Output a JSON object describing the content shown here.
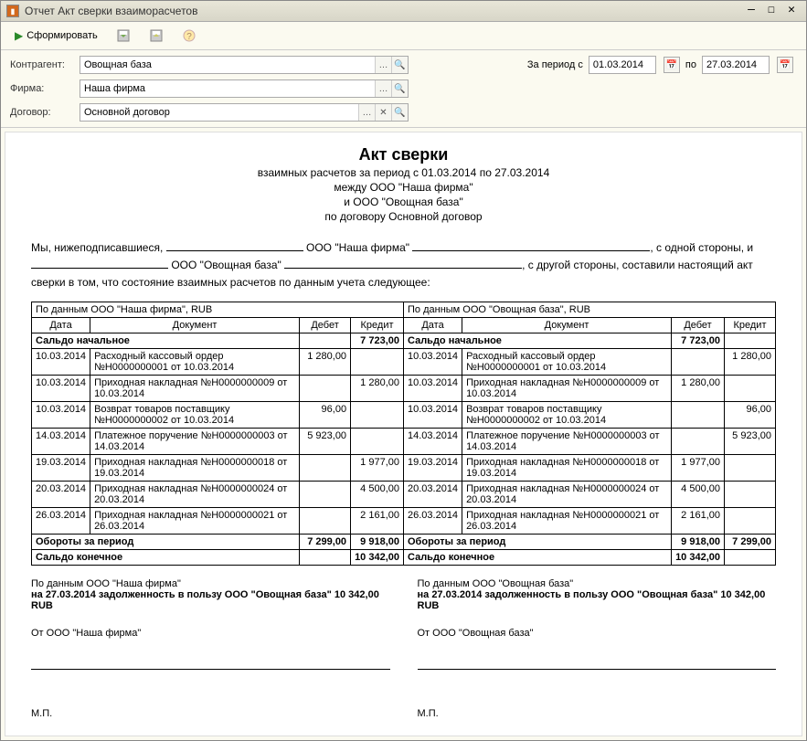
{
  "window": {
    "title": "Отчет  Акт сверки взаиморасчетов"
  },
  "toolbar": {
    "generate": "Сформировать"
  },
  "params": {
    "counterparty_label": "Контрагент:",
    "counterparty": "Овощная база",
    "firm_label": "Фирма:",
    "firm": "Наша фирма",
    "contract_label": "Договор:",
    "contract": "Основной договор",
    "period_from_label": "За период с",
    "period_from": "01.03.2014",
    "period_to_label": "по",
    "period_to": "27.03.2014"
  },
  "doc": {
    "title": "Акт сверки",
    "sub1": "взаимных расчетов за период с 01.03.2014 по 27.03.2014",
    "sub2": "между ООО \"Наша фирма\"",
    "sub3": "и ООО \"Овощная база\"",
    "sub4": "по договору Основной договор",
    "pre_we": "Мы, нижеподписавшиеся,",
    "pre_firm": "ООО \"Наша фирма\"",
    "pre_side1": ", с одной стороны, и",
    "pre_cp": "ООО \"Овощная база\"",
    "pre_side2": ", с другой стороны, составили настоящий акт сверки в том, что состояние взаимных расчетов по данным учета следующее:"
  },
  "tbl": {
    "left_hdr": "По данным ООО \"Наша фирма\", RUB",
    "right_hdr": "По данным ООО \"Овощная база\", RUB",
    "col_date": "Дата",
    "col_doc": "Документ",
    "col_debit": "Дебет",
    "col_credit": "Кредит",
    "saldo_start": "Сальдо начальное",
    "saldo_start_left": "7 723,00",
    "saldo_start_right": "7 723,00",
    "turnover": "Обороты за период",
    "left_turn_d": "7 299,00",
    "left_turn_c": "9 918,00",
    "right_turn_d": "9 918,00",
    "right_turn_c": "7 299,00",
    "saldo_end": "Сальдо конечное",
    "saldo_end_left": "10 342,00",
    "saldo_end_right": "10 342,00",
    "rows": [
      {
        "d": "10.03.2014",
        "doc": "Расходный кассовый ордер №Н0000000001 от 10.03.2014",
        "ld": "1 280,00",
        "lc": "",
        "rd": "",
        "rc": "1 280,00"
      },
      {
        "d": "10.03.2014",
        "doc": "Приходная накладная №Н0000000009 от 10.03.2014",
        "ld": "",
        "lc": "1 280,00",
        "rd": "1 280,00",
        "rc": ""
      },
      {
        "d": "10.03.2014",
        "doc": "Возврат товаров поставщику №Н0000000002 от 10.03.2014",
        "ld": "96,00",
        "lc": "",
        "rd": "",
        "rc": "96,00"
      },
      {
        "d": "14.03.2014",
        "doc": "Платежное поручение №Н0000000003 от 14.03.2014",
        "ld": "5 923,00",
        "lc": "",
        "rd": "",
        "rc": "5 923,00"
      },
      {
        "d": "19.03.2014",
        "doc": "Приходная накладная №Н0000000018 от 19.03.2014",
        "ld": "",
        "lc": "1 977,00",
        "rd": "1 977,00",
        "rc": ""
      },
      {
        "d": "20.03.2014",
        "doc": "Приходная накладная №Н0000000024 от 20.03.2014",
        "ld": "",
        "lc": "4 500,00",
        "rd": "4 500,00",
        "rc": ""
      },
      {
        "d": "26.03.2014",
        "doc": "Приходная накладная №Н0000000021 от 26.03.2014",
        "ld": "",
        "lc": "2 161,00",
        "rd": "2 161,00",
        "rc": ""
      }
    ]
  },
  "foot": {
    "left_src": "По данным ООО \"Наша фирма\"",
    "left_debt": "на 27.03.2014 задолженность в пользу ООО \"Овощная база\" 10 342,00 RUB",
    "left_from": "От ООО \"Наша фирма\"",
    "right_src": "По данным ООО \"Овощная база\"",
    "right_debt": "на 27.03.2014 задолженность в пользу ООО \"Овощная база\" 10 342,00 RUB",
    "right_from": "От ООО \"Овощная база\"",
    "mp": "М.П."
  }
}
